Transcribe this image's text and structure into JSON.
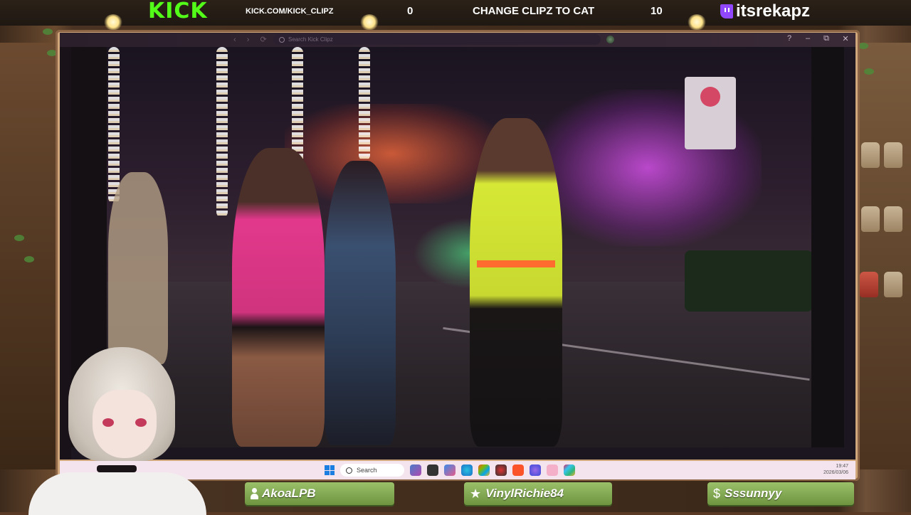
{
  "overlay": {
    "kick_logo": "KICK",
    "kick_url": "KICK.COM/KICK_CLIPZ",
    "goal_left_count": "0",
    "goal_text": "CHANGE CLIPZ TO CAT",
    "goal_right_count": "10",
    "twitch_handle": "itsrekapz"
  },
  "browser": {
    "search_placeholder": "Search Kick Clipz",
    "controls": {
      "help": "?",
      "minimize": "–",
      "restore": "⧉",
      "close": "✕"
    }
  },
  "taskbar": {
    "search_label": "Search",
    "time": "19:47",
    "date": "2026/03/06"
  },
  "chat_bar": [
    {
      "icon": "person-icon",
      "name": "AkoaLPB"
    },
    {
      "icon": "star-icon",
      "name": "VinylRichie84"
    },
    {
      "icon": "dollar-icon",
      "name": "Sssunnyy"
    }
  ],
  "colors": {
    "kick_green": "#53fc18",
    "twitch_purple": "#9146ff",
    "frame": "#cfa77a",
    "pill_green": "#8fb560"
  }
}
